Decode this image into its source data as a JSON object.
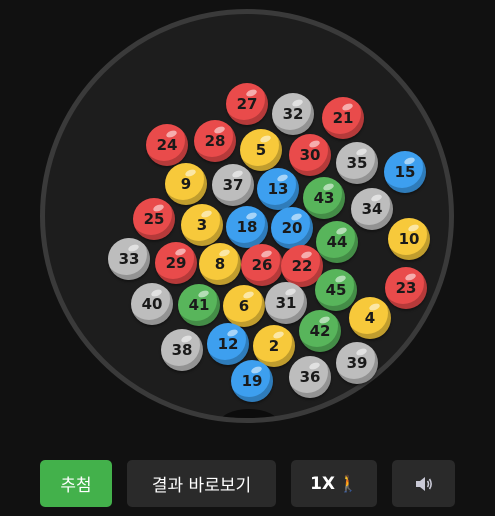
{
  "colors": {
    "yellow": "#f7c93b",
    "blue": "#3d9fef",
    "red": "#e94b4b",
    "gray": "#bdbdbd",
    "green": "#58b55b",
    "draw_button": "#43b14b",
    "button_bg": "#2a2a2a",
    "page_bg": "#111111"
  },
  "balls": [
    {
      "number": "27",
      "color": "red"
    },
    {
      "number": "32",
      "color": "gray"
    },
    {
      "number": "21",
      "color": "red"
    },
    {
      "number": "24",
      "color": "red"
    },
    {
      "number": "28",
      "color": "red"
    },
    {
      "number": "5",
      "color": "yellow"
    },
    {
      "number": "30",
      "color": "red"
    },
    {
      "number": "35",
      "color": "gray"
    },
    {
      "number": "15",
      "color": "blue"
    },
    {
      "number": "9",
      "color": "yellow"
    },
    {
      "number": "37",
      "color": "gray"
    },
    {
      "number": "13",
      "color": "blue"
    },
    {
      "number": "43",
      "color": "green"
    },
    {
      "number": "34",
      "color": "gray"
    },
    {
      "number": "25",
      "color": "red"
    },
    {
      "number": "3",
      "color": "yellow"
    },
    {
      "number": "18",
      "color": "blue"
    },
    {
      "number": "20",
      "color": "blue"
    },
    {
      "number": "44",
      "color": "green"
    },
    {
      "number": "10",
      "color": "yellow"
    },
    {
      "number": "33",
      "color": "gray"
    },
    {
      "number": "29",
      "color": "red"
    },
    {
      "number": "8",
      "color": "yellow"
    },
    {
      "number": "26",
      "color": "red"
    },
    {
      "number": "22",
      "color": "red"
    },
    {
      "number": "45",
      "color": "green"
    },
    {
      "number": "23",
      "color": "red"
    },
    {
      "number": "40",
      "color": "gray"
    },
    {
      "number": "41",
      "color": "green"
    },
    {
      "number": "6",
      "color": "yellow"
    },
    {
      "number": "31",
      "color": "gray"
    },
    {
      "number": "4",
      "color": "yellow"
    },
    {
      "number": "42",
      "color": "green"
    },
    {
      "number": "38",
      "color": "gray"
    },
    {
      "number": "12",
      "color": "blue"
    },
    {
      "number": "2",
      "color": "yellow"
    },
    {
      "number": "39",
      "color": "gray"
    },
    {
      "number": "36",
      "color": "gray"
    },
    {
      "number": "19",
      "color": "blue"
    }
  ],
  "controls": {
    "draw_label": "추첨",
    "result_label": "결과 바로보기",
    "speed_label": "1X",
    "speed_icon": "walking-person-icon",
    "sound_icon": "speaker-icon"
  }
}
